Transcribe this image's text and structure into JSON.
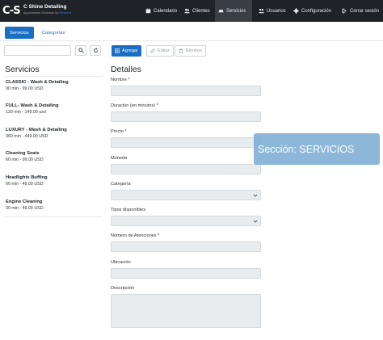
{
  "brand": {
    "logo_mark": "C-S",
    "name": "C Shine Detailing",
    "tagline_prefix": "Appointment Schedule by",
    "tagline_by": "Reserbiz"
  },
  "nav": {
    "items": [
      {
        "label": "Calendario",
        "icon": "calendar-icon"
      },
      {
        "label": "Clientes",
        "icon": "users-icon"
      },
      {
        "label": "Servicios",
        "icon": "car-icon",
        "active": true
      },
      {
        "label": "Usuarios",
        "icon": "user-group-icon"
      },
      {
        "label": "Configuración",
        "icon": "gear-icon"
      },
      {
        "label": "Cerrar sesión",
        "icon": "logout-icon"
      }
    ]
  },
  "tabs": [
    {
      "label": "Servicios",
      "active": true
    },
    {
      "label": "Categorías",
      "active": false
    }
  ],
  "search": {
    "value": "",
    "placeholder": ""
  },
  "services": {
    "title": "Servicios",
    "items": [
      {
        "name": "CLASSIC - Wash & Detailing",
        "meta": "90 min - 99.00 USD"
      },
      {
        "name": "FULL- Wash & Detailing",
        "meta": "120 min - 149.00 usd"
      },
      {
        "name": "LUXURY - Wash & Detailing",
        "meta": "360 min - 449.00 USD"
      },
      {
        "name": "Cleaning Seats",
        "meta": "60 min - 99.00 USD"
      },
      {
        "name": "Headlights Buffing",
        "meta": "60 min - 49.00 USD"
      },
      {
        "name": "Engine Cleaning",
        "meta": "30 min - 49.00 USD"
      }
    ]
  },
  "toolbar": {
    "add_label": "Agregar",
    "edit_label": "Editar",
    "delete_label": "Eliminar"
  },
  "details": {
    "title": "Detalles",
    "fields": [
      {
        "label": "Nombre *",
        "value": "",
        "type": "text"
      },
      {
        "label": "Duración (en minutos) *",
        "value": "",
        "type": "text"
      },
      {
        "label": "Precio *",
        "value": "",
        "type": "text"
      },
      {
        "label": "Moneda",
        "value": "",
        "type": "text"
      },
      {
        "label": "Categoría",
        "value": "",
        "type": "select"
      },
      {
        "label": "Tipos disponibles",
        "value": "",
        "type": "select"
      },
      {
        "label": "Número de Atenciones *",
        "value": "",
        "type": "text"
      },
      {
        "label": "Ubicación",
        "value": "",
        "type": "text"
      },
      {
        "label": "Descripción",
        "value": "",
        "type": "textarea"
      }
    ]
  },
  "banner": {
    "text": "Sección:  SERVICIOS"
  },
  "colors": {
    "navbar": "#1f2226",
    "primary": "#1b6ec2",
    "field_bg": "#e9ecef",
    "banner": "#78aad2"
  }
}
